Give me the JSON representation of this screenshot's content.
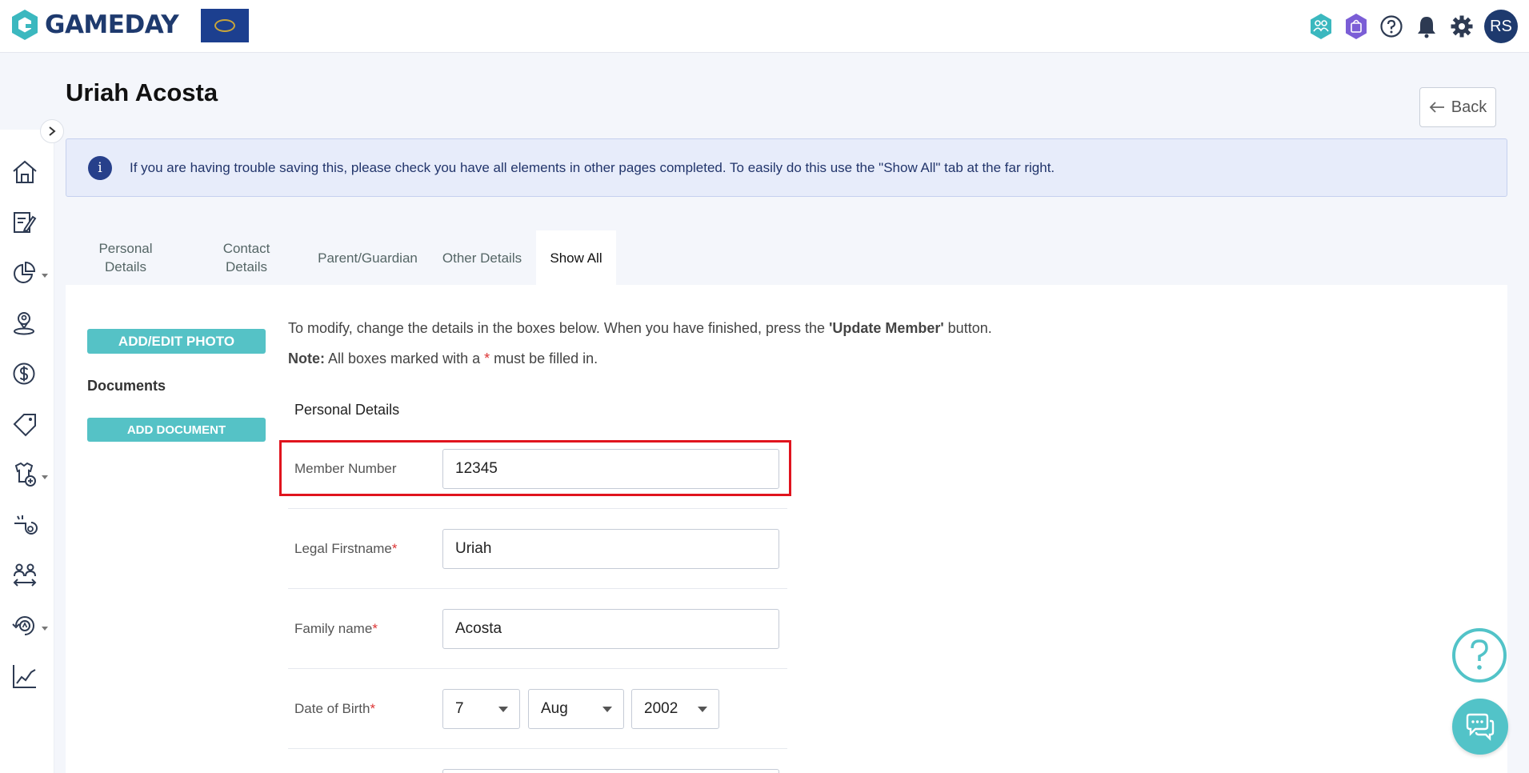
{
  "brand": {
    "name": "GAMEDAY",
    "primary_color": "#1e3a6e",
    "accent_color": "#55c2c6"
  },
  "topbar": {
    "icons": [
      "teams-icon",
      "shop-icon",
      "help-circle-icon",
      "bell-icon",
      "gear-icon"
    ],
    "avatar_initials": "RS"
  },
  "sidebar": {
    "items": [
      {
        "icon": "home-icon",
        "has_dropdown": false
      },
      {
        "icon": "edit-document-icon",
        "has_dropdown": false
      },
      {
        "icon": "pie-chart-icon",
        "has_dropdown": true
      },
      {
        "icon": "member-location-icon",
        "has_dropdown": false
      },
      {
        "icon": "dollar-icon",
        "has_dropdown": false
      },
      {
        "icon": "tag-icon",
        "has_dropdown": false
      },
      {
        "icon": "jersey-add-icon",
        "has_dropdown": true
      },
      {
        "icon": "whistle-icon",
        "has_dropdown": false
      },
      {
        "icon": "transfer-people-icon",
        "has_dropdown": false
      },
      {
        "icon": "competition-icon",
        "has_dropdown": true
      },
      {
        "icon": "line-chart-icon",
        "has_dropdown": false
      }
    ]
  },
  "page": {
    "title": "Uriah Acosta",
    "back_label": "Back"
  },
  "banner": {
    "icon_glyph": "i",
    "text": "If you are having trouble saving this, please check you have all elements in other pages completed. To easily do this use the \"Show All\" tab at the far right."
  },
  "tabs": [
    {
      "line1": "Personal",
      "line2": "Details",
      "active": false
    },
    {
      "line1": "Contact",
      "line2": "Details",
      "active": false
    },
    {
      "line1": "Parent/Guardian",
      "line2": "",
      "active": false
    },
    {
      "line1": "Other Details",
      "line2": "",
      "active": false
    },
    {
      "line1": "Show All",
      "line2": "",
      "active": true
    }
  ],
  "left_panel": {
    "photo_button": "ADD/EDIT PHOTO",
    "documents_label": "Documents",
    "add_document_button": "ADD DOCUMENT"
  },
  "instructions": {
    "prefix": "To modify, change the details in the boxes below. When you have finished, press the ",
    "button_ref": "'Update Member'",
    "suffix": " button.",
    "note_label": "Note:",
    "note_text_a": " All boxes marked with a ",
    "note_star": "*",
    "note_text_b": " must be filled in."
  },
  "form": {
    "section_title": "Personal Details",
    "member_number": {
      "label": "Member Number",
      "value": "12345"
    },
    "first_name": {
      "label": "Legal Firstname",
      "required": "*",
      "value": "Uriah"
    },
    "family_name": {
      "label": "Family name",
      "required": "*",
      "value": "Acosta"
    },
    "dob": {
      "label": "Date of Birth",
      "required": "*",
      "day": "7",
      "month": "Aug",
      "year": "2002"
    }
  }
}
